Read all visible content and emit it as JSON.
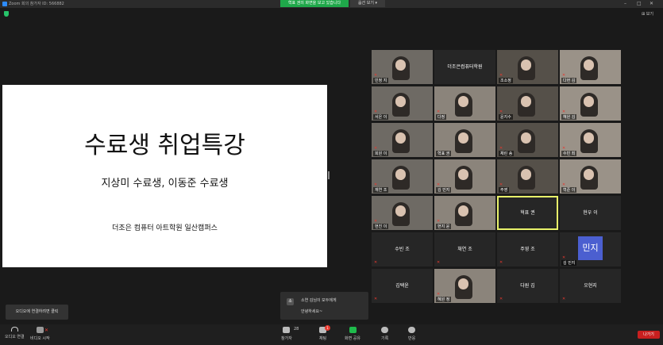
{
  "window": {
    "title": "Zoom 회의 참가자 ID: 566882",
    "share_banner": "혁표 권의 화면을 보고 있습니다",
    "view_options": "옵션 보기 ▾",
    "gallery_toggle": "⊞ 보기"
  },
  "slide": {
    "title": "수료생 취업특강",
    "subtitle": "지상미 수료생, 이동준 수료생",
    "org": "더조은 컴퓨터 아트학원 일산캠퍼스"
  },
  "participants": [
    {
      "name": "민정 지",
      "kind": "video",
      "muted": true
    },
    {
      "name": "더조은컴퓨터학원",
      "kind": "center",
      "muted": false
    },
    {
      "name": "조소정",
      "kind": "video",
      "muted": true
    },
    {
      "name": "다현 김",
      "kind": "video",
      "muted": true
    },
    {
      "name": "서은 이",
      "kind": "video",
      "muted": true
    },
    {
      "name": "다정",
      "kind": "video",
      "muted": true
    },
    {
      "name": "윤지수",
      "kind": "video",
      "muted": true
    },
    {
      "name": "혜원 김",
      "kind": "video",
      "muted": true
    },
    {
      "name": "희원 이",
      "kind": "video",
      "muted": true
    },
    {
      "name": "혁표 권",
      "kind": "video",
      "muted": false
    },
    {
      "name": "채린 송",
      "kind": "video",
      "muted": true
    },
    {
      "name": "수빈 최",
      "kind": "video",
      "muted": true
    },
    {
      "name": "재연 조",
      "kind": "video",
      "muted": true
    },
    {
      "name": "김 민지",
      "kind": "video",
      "muted": true
    },
    {
      "name": "주영",
      "kind": "video",
      "muted": true
    },
    {
      "name": "혁준 이",
      "kind": "video",
      "muted": true
    },
    {
      "name": "현진 이",
      "kind": "video",
      "muted": true
    },
    {
      "name": "현지 윤",
      "kind": "video",
      "muted": true
    },
    {
      "name": "혁표 권",
      "kind": "center",
      "muted": false,
      "active": true
    },
    {
      "name": "현우 이",
      "kind": "center",
      "muted": false
    },
    {
      "name": "수빈 조",
      "kind": "center",
      "muted": true
    },
    {
      "name": "채연 조",
      "kind": "center",
      "muted": true
    },
    {
      "name": "주영 조",
      "kind": "center",
      "muted": true
    },
    {
      "name": "김 민지",
      "kind": "avatar",
      "avatar_text": "민지",
      "muted": true
    },
    {
      "name": "김택윤",
      "kind": "center",
      "muted": true
    },
    {
      "name": "혜원 정",
      "kind": "video",
      "muted": true
    },
    {
      "name": "다원 김",
      "kind": "center",
      "muted": true
    },
    {
      "name": "오현지",
      "kind": "center",
      "muted": true
    }
  ],
  "audio_notice": "오디오에 연결하려면 클릭",
  "chat_popup": {
    "avatar": "소",
    "from": "소연 김님이 모두에게",
    "message": "안녕하세요~"
  },
  "toolbar": {
    "audio": "오디오 연결",
    "video": "비디오 시작",
    "participants": "참가자",
    "participants_count": "28",
    "chat": "채팅",
    "chat_badge": "1",
    "share": "화면 공유",
    "record": "기록",
    "reactions": "반응",
    "leave": "나가기"
  },
  "colors": {
    "share_green": "#1fa84a",
    "active_border": "#e8f26a",
    "muted_red": "#e8392f",
    "leave_red": "#c81f1f",
    "avatar_blue": "#4b5fd0"
  }
}
